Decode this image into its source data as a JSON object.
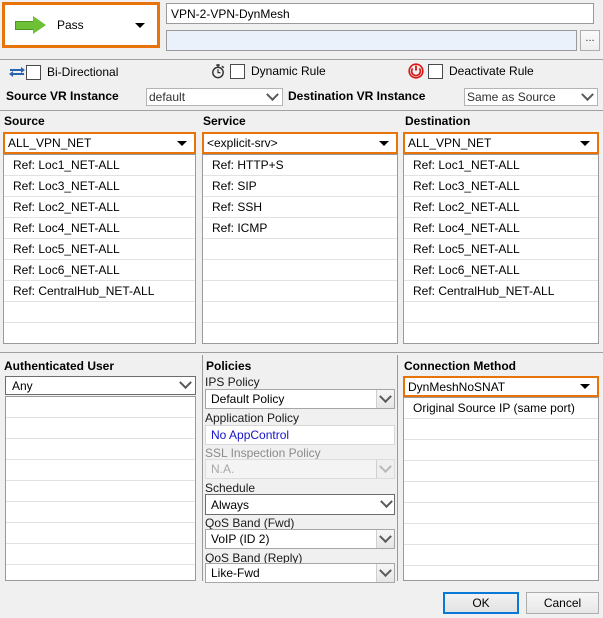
{
  "action": {
    "label": "Pass",
    "icon": "green-right-arrow-icon",
    "accent_color": "#e8730a",
    "arrow_color": "#6ec036"
  },
  "rule": {
    "name_value": "VPN-2-VPN-DynMesh",
    "description_value": "",
    "browse_button_label": "...",
    "description_bg": "#eaf1fa"
  },
  "options_row": [
    {
      "icon": "bi-directional-arrows-icon",
      "label": "Bi-Directional",
      "checked": false
    },
    {
      "icon": "stopwatch-icon",
      "label": "Dynamic Rule",
      "checked": false
    },
    {
      "icon": "power-off-icon",
      "label": "Deactivate Rule",
      "checked": false
    }
  ],
  "vr_instance": {
    "source_label": "Source VR Instance",
    "source_value": "default",
    "destination_label": "Destination VR Instance",
    "destination_value": "Same as Source"
  },
  "columns": {
    "source": {
      "header": "Source",
      "selected": "ALL_VPN_NET",
      "items": [
        "Ref: Loc1_NET-ALL",
        "Ref: Loc3_NET-ALL",
        "Ref: Loc2_NET-ALL",
        "Ref: Loc4_NET-ALL",
        "Ref: Loc5_NET-ALL",
        "Ref: Loc6_NET-ALL",
        "Ref: CentralHub_NET-ALL"
      ]
    },
    "service": {
      "header": "Service",
      "selected": "<explicit-srv>",
      "items": [
        "Ref: HTTP+S",
        "Ref: SIP",
        "Ref: SSH",
        "Ref: ICMP"
      ]
    },
    "destination": {
      "header": "Destination",
      "selected": "ALL_VPN_NET",
      "items": [
        "Ref: Loc1_NET-ALL",
        "Ref: Loc3_NET-ALL",
        "Ref: Loc2_NET-ALL",
        "Ref: Loc4_NET-ALL",
        "Ref: Loc5_NET-ALL",
        "Ref: Loc6_NET-ALL",
        "Ref: CentralHub_NET-ALL"
      ]
    }
  },
  "authenticated_user": {
    "header": "Authenticated User",
    "selected": "Any",
    "items": []
  },
  "policies": {
    "header": "Policies",
    "fields": [
      {
        "label": "IPS Policy",
        "value": "Default Policy",
        "style": "normal"
      },
      {
        "label": "Application Policy",
        "value": "No AppControl",
        "style": "link"
      },
      {
        "label": "SSL Inspection Policy",
        "value": "N.A.",
        "style": "disabled"
      },
      {
        "label": "Schedule",
        "value": "Always",
        "style": "focused"
      },
      {
        "label": "QoS Band (Fwd)",
        "value": "VoIP (ID 2)",
        "style": "normal"
      },
      {
        "label": "QoS Band (Reply)",
        "value": "Like-Fwd",
        "style": "normal"
      }
    ]
  },
  "connection_method": {
    "header": "Connection Method",
    "selected": "DynMeshNoSNAT",
    "items": [
      "Original Source IP (same port)"
    ]
  },
  "footer": {
    "ok_label": "OK",
    "cancel_label": "Cancel"
  }
}
